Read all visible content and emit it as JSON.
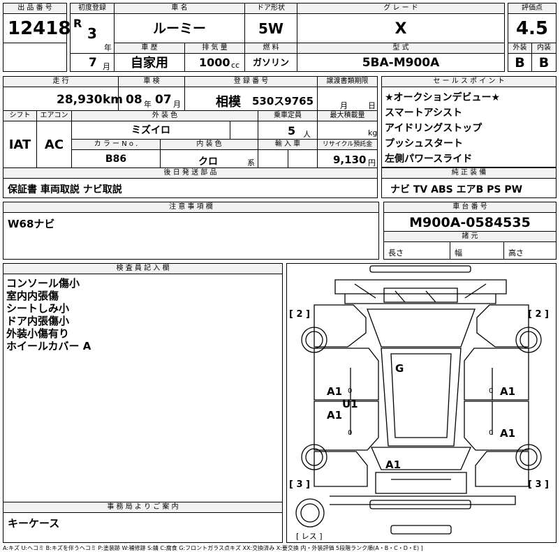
{
  "lot": {
    "header": "出 品 番 号",
    "value": "12418"
  },
  "first_reg": {
    "header": "初度登録",
    "era": "R",
    "year": "3",
    "year_unit": "年",
    "month": "7",
    "month_unit": "月"
  },
  "car_name": {
    "header": "車 名",
    "value": "ルーミー"
  },
  "door": {
    "header": "ドア形状",
    "value": "5W"
  },
  "grade": {
    "header": "グ レ ー ド",
    "value": "X"
  },
  "score": {
    "header": "評価点",
    "value": "4.5"
  },
  "history": {
    "header": "車 歴",
    "value": "自家用"
  },
  "displacement": {
    "header": "排 気 量",
    "value": "1000",
    "unit": "cc"
  },
  "fuel": {
    "header": "燃 料",
    "value": "ガソリン"
  },
  "model": {
    "header": "型 式",
    "value": "5BA-M900A"
  },
  "exterior_grade": {
    "header": "外装",
    "value": "B"
  },
  "interior_grade": {
    "header": "内装",
    "value": "B"
  },
  "mileage": {
    "header": "走 行",
    "value": "28,930",
    "unit": "km"
  },
  "inspection": {
    "header": "車 検",
    "year": "08",
    "year_unit": "年",
    "month": "07",
    "month_unit": "月"
  },
  "registration": {
    "header": "登 録 番 号",
    "region": "相模",
    "number": "530ス9765"
  },
  "transfer_deadline": {
    "header": "譲渡書類期限",
    "month_unit": "月",
    "day_unit": "日"
  },
  "sales_points": {
    "header": "セ ー ル ス ポ イ ン ト",
    "items": [
      "★オークションデビュー★",
      "スマートアシスト",
      "アイドリングストップ",
      "プッシュスタート",
      "左側パワースライド"
    ]
  },
  "shift": {
    "header": "シフト",
    "value": "IAT"
  },
  "aircon": {
    "header": "エアコン",
    "value": "AC"
  },
  "exterior_color": {
    "header": "外 装 色",
    "value": "ミズイロ"
  },
  "capacity": {
    "header": "乗車定員",
    "value": "5",
    "unit": "人"
  },
  "max_load": {
    "header": "最大積載量",
    "unit": "kg"
  },
  "color_no": {
    "header": "カ ラ ー N o .",
    "value": "B86"
  },
  "interior_color": {
    "header": "内 装 色",
    "value": "クロ",
    "unit": "系"
  },
  "import": {
    "header": "輸 入 車"
  },
  "recycle": {
    "header": "リサイクル預託金",
    "value": "9,130",
    "unit": "円"
  },
  "later_parts": {
    "header": "後 日 発 送 部 品",
    "value": "保証書 車両取説 ナビ取説"
  },
  "equipment": {
    "header": "純 正 装 備",
    "value": "ナビ TV ABS エアB PS PW"
  },
  "notes": {
    "header": "注 意 事 項 欄",
    "value": "W68ナビ"
  },
  "chassis": {
    "header": "車 台 番 号",
    "value": "M900A-0584535"
  },
  "dims": {
    "header": "諸 元",
    "length": "長さ",
    "width": "幅",
    "height": "高さ"
  },
  "inspector": {
    "header": "検 査 員 記 入 欄",
    "lines": [
      "コンソール傷小",
      "室内内張傷",
      "シートしみ小",
      "ドア内張傷小",
      "外装小傷有り",
      "ホイールカバー A"
    ]
  },
  "office": {
    "header": "事 務 局 よ り ご 案 内",
    "value": "キーケース"
  },
  "diagram": {
    "tl": "[ 2 ]",
    "tr": "[ 2 ]",
    "bl": "[ 3 ]",
    "br": "[ 3 ]",
    "spare": "[ レス ]",
    "g": "G",
    "u1": "U1",
    "a1_l1": "A1",
    "a1_l2": "A1",
    "a1_r1": "A1",
    "a1_r2": "A1",
    "a1_b": "A1",
    "z": "0"
  },
  "legend": "A:キズ U:ヘコミ B:キズを伴うヘコミ P:塗装跡 W:補修跡 S:錆 C:腐食 G:フロントガラス点キズ XX:交換済み X:要交換 内・外装評価 5段階ランク順(A・B・C・D・E) ]"
}
